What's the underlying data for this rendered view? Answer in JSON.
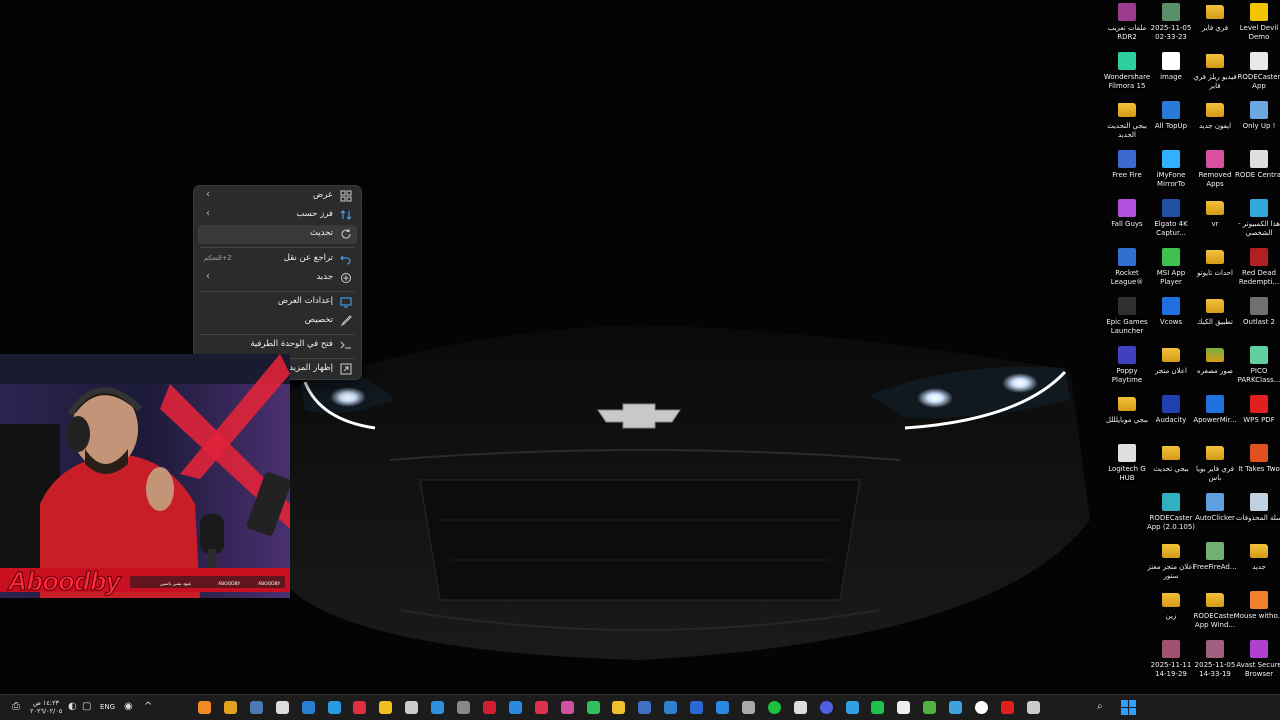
{
  "context_menu": {
    "items": [
      {
        "label": "عرض",
        "icon": "grid-icon",
        "submenu": true
      },
      {
        "label": "فرز حسب",
        "icon": "sort-icon",
        "submenu": true
      },
      {
        "label": "تحديث",
        "icon": "refresh-icon"
      },
      {
        "label": "تراجع عن نقل",
        "icon": "undo-icon",
        "shortcut": "التحكم+Z"
      },
      {
        "label": "جديد",
        "icon": "new-icon",
        "submenu": true
      },
      {
        "label": "إعدادات العرض",
        "icon": "display-icon"
      },
      {
        "label": "تخصيص",
        "icon": "brush-icon"
      },
      {
        "label": "فتح في الوحدة الطرفية",
        "icon": "terminal-icon"
      },
      {
        "label": "إظهار المزيد من الخيارات",
        "icon": "more-icon"
      }
    ]
  },
  "desktop_icons": [
    {
      "label": "Level Devil Demo",
      "icon": "level-devil-icon",
      "color": "#f5c400"
    },
    {
      "label": "فري فاير",
      "icon": "folder-icon",
      "color": "#f3c13a"
    },
    {
      "label": "2025-11-05 02-33-23",
      "icon": "video-file-icon",
      "color": "#5a8f6a"
    },
    {
      "label": "ملفات تعريب RDR2",
      "icon": "winrar-icon",
      "color": "#9b3c8c"
    },
    {
      "label": "RODECaster App",
      "icon": "rodecaster-icon",
      "color": "#e8e8e8"
    },
    {
      "label": "فيديو ريلز فري فاير",
      "icon": "folder-icon",
      "color": "#f3c13a"
    },
    {
      "label": "image",
      "icon": "image-file-icon",
      "color": "#ffffff"
    },
    {
      "label": "Wondershare Filmora 15",
      "icon": "filmora-icon",
      "color": "#2fd0a0"
    },
    {
      "label": "Only Up !",
      "icon": "onlyup-icon",
      "color": "#6aa8e0"
    },
    {
      "label": "ايفون جديد",
      "icon": "folder-icon",
      "color": "#f3c13a"
    },
    {
      "label": "All TopUp",
      "icon": "topup-icon",
      "color": "#2a7ad8"
    },
    {
      "label": "ببجي التحديث الجديد",
      "icon": "folder-icon",
      "color": "#f3c13a"
    },
    {
      "label": "RODE Central",
      "icon": "rode-central-icon",
      "color": "#e0e0e0"
    },
    {
      "label": "Removed Apps",
      "icon": "removed-apps-icon",
      "color": "#d850a0"
    },
    {
      "label": "iMyFone MirrorTo",
      "icon": "mirrorto-icon",
      "color": "#30b0ff"
    },
    {
      "label": "Free Fire",
      "icon": "freefire-icon",
      "color": "#3a6ad0"
    },
    {
      "label": "هذا الكمبيوتر - الشخصي",
      "icon": "pc-icon",
      "color": "#30a8d8"
    },
    {
      "label": "vr",
      "icon": "folder-icon",
      "color": "#f3c13a"
    },
    {
      "label": "Elgato 4K Captur...",
      "icon": "elgato-icon",
      "color": "#2050a0"
    },
    {
      "label": "Fall Guys",
      "icon": "fallguys-icon",
      "color": "#b050e0"
    },
    {
      "label": "Red Dead Redempti...",
      "icon": "rdr-icon",
      "color": "#b02020"
    },
    {
      "label": "احداث تايوتو",
      "icon": "folder-icon",
      "color": "#f3c13a"
    },
    {
      "label": "MSI App Player",
      "icon": "msi-icon",
      "color": "#40c050"
    },
    {
      "label": "Rocket League®",
      "icon": "rocket-league-icon",
      "color": "#3070d0"
    },
    {
      "label": "Outlast 2",
      "icon": "outlast-icon",
      "color": "#707070"
    },
    {
      "label": "تطبيق الكيك",
      "icon": "folder-icon",
      "color": "#f3c13a"
    },
    {
      "label": "Vcows",
      "icon": "vcows-icon",
      "color": "#2070e0"
    },
    {
      "label": "Epic Games Launcher",
      "icon": "epic-icon",
      "color": "#303030"
    },
    {
      "label": "PICO PARKClass...",
      "icon": "pico-icon",
      "color": "#60d0a0"
    },
    {
      "label": "صور مصغره",
      "icon": "folder-icon",
      "color": "#7ab040"
    },
    {
      "label": "اعلان متجر",
      "icon": "folder-icon",
      "color": "#f3c13a"
    },
    {
      "label": "Poppy Playtime",
      "icon": "poppy-icon",
      "color": "#4040c0"
    },
    {
      "label": "WPS PDF",
      "icon": "wps-icon",
      "color": "#e02020"
    },
    {
      "label": "ApowerMir...",
      "icon": "apower-icon",
      "color": "#2070e0"
    },
    {
      "label": "Audacity",
      "icon": "audacity-icon",
      "color": "#2040b0"
    },
    {
      "label": "ببجي موبايلللل",
      "icon": "folder-icon",
      "color": "#f3c13a"
    },
    {
      "label": "It Takes Two",
      "icon": "ittakestwo-icon",
      "color": "#e05020"
    },
    {
      "label": "فري فاير يويا باس",
      "icon": "folder-icon",
      "color": "#f3c13a"
    },
    {
      "label": "ببجي تحديث",
      "icon": "folder-icon",
      "color": "#f3c13a"
    },
    {
      "label": "Logitech G HUB",
      "icon": "ghub-icon",
      "color": "#e0e0e0"
    },
    {
      "label": "سلة المحذوفات",
      "icon": "recycle-bin-icon",
      "color": "#c0d0e0"
    },
    {
      "label": "AutoClicker",
      "icon": "autoclicker-icon",
      "color": "#60a0e0"
    },
    {
      "label": "RODECaster App (2.0.105)",
      "icon": "rodecaster-icon",
      "color": "#30b0c0"
    },
    {
      "label": "جديد",
      "icon": "folder-icon",
      "color": "#f3c13a"
    },
    {
      "label": "FreeFireAd...",
      "icon": "freefire-ad-icon",
      "color": "#70b070"
    },
    {
      "label": "اعلان متجر معتز ستور",
      "icon": "folder-icon",
      "color": "#f3c13a"
    },
    {
      "label": "Mouse witho...",
      "icon": "mouse-icon",
      "color": "#f08030"
    },
    {
      "label": "RODECaster App Wind...",
      "icon": "folder-icon",
      "color": "#f3c13a"
    },
    {
      "label": "زين",
      "icon": "folder-icon",
      "color": "#f3c13a"
    },
    {
      "label": "Avast Secure Browser",
      "icon": "avast-icon",
      "color": "#b040d0"
    },
    {
      "label": "2025-11-05 14-33-19",
      "icon": "video-file-icon",
      "color": "#a06080"
    },
    {
      "label": "2025-11-11 14-19-29",
      "icon": "video-file-icon",
      "color": "#a05070"
    }
  ],
  "webcam": {
    "overlay_name": "Aboodby",
    "bar_items": [
      "ABOODBY",
      "ABOODBY",
      "عبود بشي ياسين"
    ]
  },
  "taskbar": {
    "clock_time": "١٤:٢٣ ص",
    "clock_date": "٢٠٢٦/٠٢/٠٥",
    "language": "ENG",
    "colors": {
      "accent": "#0a84ff",
      "start": "#0a84ff"
    }
  }
}
